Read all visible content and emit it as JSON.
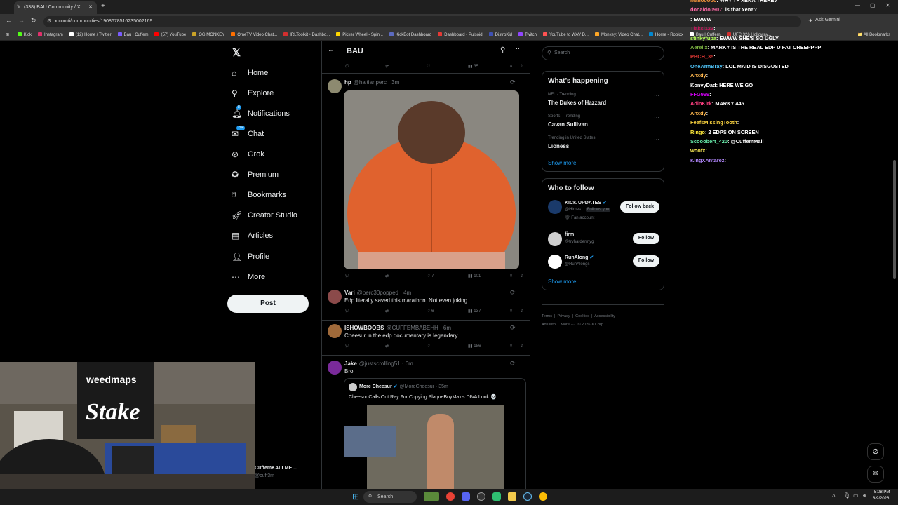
{
  "browser": {
    "tab_title": "(338) BAU Community / X",
    "url": "x.com/i/communities/1908678516235002169",
    "ask_gemini": "Ask Gemini",
    "bookmarks": [
      "Kick",
      "Instagram",
      "(12) Home / Twitter",
      "Bau | Cuffem",
      "(57) YouTube",
      "OG MONKEY",
      "OmeTV Video Chat...",
      "IRLToolkit • Dashbo...",
      "Picker Wheel - Spin...",
      "KickBot Dashboard",
      "Dashboard - Pulsoid",
      "DistroKid",
      "Twitch",
      "YouTube to WAV D...",
      "Monkey: Video Chat...",
      "Home - Roblox",
      "Bau | Cuffem",
      "UFC 326 Holloway..."
    ],
    "all_bookmarks": "All Bookmarks"
  },
  "nav": {
    "items": [
      {
        "label": "Home",
        "icon": "home-icon"
      },
      {
        "label": "Explore",
        "icon": "search-icon"
      },
      {
        "label": "Notifications",
        "icon": "bell-icon",
        "badge": "8"
      },
      {
        "label": "Chat",
        "icon": "chat-icon",
        "badge": "20+"
      },
      {
        "label": "Grok",
        "icon": "grok-icon"
      },
      {
        "label": "Premium",
        "icon": "premium-icon"
      },
      {
        "label": "Bookmarks",
        "icon": "bookmark-icon"
      },
      {
        "label": "Creator Studio",
        "icon": "rocket-icon"
      },
      {
        "label": "Articles",
        "icon": "article-icon"
      },
      {
        "label": "Profile",
        "icon": "profile-icon"
      },
      {
        "label": "More",
        "icon": "more-icon"
      }
    ],
    "post_label": "Post",
    "account_name": "CuffemKALLME ...",
    "account_handle": "@cuff3m"
  },
  "header": {
    "title": "BAU"
  },
  "tweets": [
    {
      "name": "hp",
      "handle": "@haitianperc · 3m",
      "text": "",
      "stats": {
        "reply": "",
        "retweet": "",
        "like": "7",
        "views": "101"
      }
    },
    {
      "name": "Vari",
      "handle": "@perc30popped · 4m",
      "text": "Edp literally saved this marathon. Not even joking",
      "stats": {
        "reply": "",
        "retweet": "",
        "like": "6",
        "views": "137"
      }
    },
    {
      "name": "ISHOWBOOBS",
      "handle": "@CUFFEMBABEHH · 6m",
      "text": "Cheesur in the edp documentary is legendary",
      "stats": {
        "reply": "",
        "retweet": "",
        "like": "",
        "views": "186"
      }
    },
    {
      "name": "Jake",
      "handle": "@justscrolling51 · 6m",
      "text": "Bro",
      "quote": {
        "name": "More Cheesur",
        "handle": "@MoreCheesur · 35m",
        "text": "Cheesur Calls Out Ray For Copying PlaqueBoyMax's DIVA Look 💀"
      }
    }
  ],
  "top_stats": {
    "views": "35"
  },
  "right": {
    "search_placeholder": "Search",
    "whats_happening": "What’s happening",
    "trends": [
      {
        "meta": "NFL · Trending",
        "name": "The Dukes of Hazzard"
      },
      {
        "meta": "Sports · Trending",
        "name": "Cavan Sullivan"
      },
      {
        "meta": "Trending in United States",
        "name": "Lioness"
      }
    ],
    "show_more": "Show more",
    "who_to_follow": "Who to follow",
    "follow": [
      {
        "name": "KICK UPDATES",
        "handle": "@Hlmes...",
        "tag": "Follows you",
        "sub": "Fan account",
        "button": "Follow back"
      },
      {
        "name": "firm",
        "handle": "@tryhardermyg",
        "button": "Follow"
      },
      {
        "name": "RunAlong",
        "handle": "@RunAlongs",
        "button": "Follow"
      }
    ],
    "footer": [
      "Terms",
      "Privacy",
      "Cookies",
      "Accessibility",
      "Ads info",
      "More ···",
      "© 2026 X Corp."
    ]
  },
  "chat": [
    {
      "user": "Mahooooo",
      "msg": "WHY TF XENA THERE?",
      "color": "#ff9a3c"
    },
    {
      "user": "donaldo0907",
      "msg": "is that xena?",
      "color": "#ff6ba8"
    },
    {
      "user": "",
      "msg": "EWWW",
      "color": "#f5d142"
    },
    {
      "user": "Tiaksi123",
      "msg": "",
      "color": "#c2185b"
    },
    {
      "user": "stinkyfupa",
      "msg": "EWWW SHE'S SO UGLY",
      "color": "#b2ff59"
    },
    {
      "user": "Aerelix",
      "msg": "MARKY IS THE REAL EDP U FAT CREEPPPP",
      "color": "#7cb342"
    },
    {
      "user": "PBCH_35",
      "msg": "",
      "color": "#e53935"
    },
    {
      "user": "OneArmBray",
      "msg": "LOL MAID IS DISGUSTED",
      "color": "#4fc3f7"
    },
    {
      "user": "Anxdy",
      "msg": "",
      "color": "#ffb74d"
    },
    {
      "user": "KonvyDad",
      "msg": "HERE WE GO",
      "color": "#ffffff"
    },
    {
      "user": "FFG999",
      "msg": "",
      "color": "#d500f9"
    },
    {
      "user": "AdinKirk",
      "msg": "MARKY 445",
      "color": "#ff4081"
    },
    {
      "user": "Anxdy",
      "msg": "",
      "color": "#ffb74d"
    },
    {
      "user": "FeefsMissingTooth",
      "msg": "",
      "color": "#ffd740"
    },
    {
      "user": "Ringo",
      "msg": "2 EDPS ON SCREEN",
      "color": "#ffeb3b"
    },
    {
      "user": "Scooobert_420",
      "msg": "@CuffemMail",
      "color": "#69f0ae"
    },
    {
      "user": "woofx",
      "msg": "",
      "color": "#ffee58"
    },
    {
      "user": "KingXAntarez",
      "msg": "",
      "color": "#b388ff"
    }
  ],
  "taskbar": {
    "search": "Search",
    "time": "5:08 PM",
    "date": "8/9/2026"
  }
}
